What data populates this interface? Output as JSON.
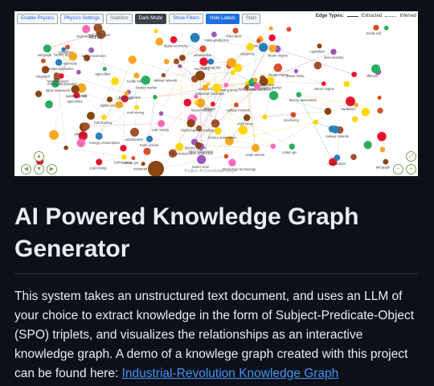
{
  "toolbar": {
    "buttons": [
      {
        "label": "Enable Physics"
      },
      {
        "label": "Physics Settings"
      },
      {
        "label": "Stabilize"
      },
      {
        "label": "Dark Mode"
      },
      {
        "label": "Show Filters"
      },
      {
        "label": "Hide Labels"
      },
      {
        "label": "Stats"
      }
    ]
  },
  "legend": {
    "title": "Edge Types:",
    "extracted": "Extracted",
    "inferred": "Inferred"
  },
  "graph": {
    "caption": "Project: AI Knowledge Graph",
    "node_colors": [
      "#8b4513",
      "#f5a623",
      "#e8112d",
      "#d94f2b",
      "#9b59b6",
      "#2980b9",
      "#27ae60",
      "#ffd700",
      "#ff69b4",
      "#a0522d"
    ],
    "node_labels": [
      "offshore",
      "factory automation",
      "steam engine",
      "textile mill",
      "coal mining",
      "railway network",
      "industrial revolution",
      "labor movement",
      "factory system",
      "urbanization",
      "child labor",
      "cotton gin",
      "iron production",
      "telegraph",
      "electricity",
      "mass production",
      "capitalism",
      "trade unions",
      "machinery",
      "agriculture",
      "spinning jenny",
      "power loom",
      "blockchain technology",
      "factory worker",
      "energy consumption",
      "digital economy",
      "ball bearing",
      "steel industry",
      "industrial city",
      "heavy industry"
    ]
  },
  "page": {
    "title": "AI Powered Knowledge Graph Generator",
    "description": "This system takes an unstructured text document, and uses an LLM of your choice to extract knowledge in the form of Subject-Predicate-Object (SPO) triplets, and visualizes the relationships as an interactive knowledge graph. A demo of a knowlege graph created with this project can be found here:",
    "link_text": "Industrial-Revolution Knowledge Graph"
  }
}
